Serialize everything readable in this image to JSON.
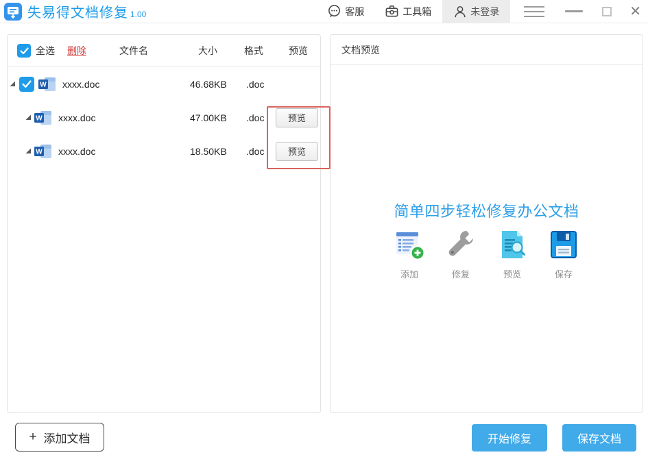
{
  "titlebar": {
    "app_title": "失易得文档修复",
    "version": "1.00",
    "service_label": "客服",
    "toolbox_label": "工具箱",
    "login_label": "未登录"
  },
  "file_panel": {
    "header": {
      "select_all": "全选",
      "delete": "删除",
      "filename": "文件名",
      "size": "大小",
      "format": "格式",
      "preview": "预览"
    },
    "rows": [
      {
        "name": "xxxx.doc",
        "size": "46.68KB",
        "format": ".doc"
      },
      {
        "name": "xxxx.doc",
        "size": "47.00KB",
        "format": ".doc",
        "preview_label": "预览"
      },
      {
        "name": "xxxx.doc",
        "size": "18.50KB",
        "format": ".doc",
        "preview_label": "预览"
      }
    ],
    "add_plus": "+",
    "add_label": "添加文档"
  },
  "preview_panel": {
    "header": "文档预览",
    "headline": "简单四步轻松修复办公文档",
    "steps": [
      {
        "label": "添加",
        "icon": "add-document-icon"
      },
      {
        "label": "修复",
        "icon": "repair-wrench-icon"
      },
      {
        "label": "预览",
        "icon": "preview-document-icon"
      },
      {
        "label": "保存",
        "icon": "save-disk-icon"
      }
    ]
  },
  "footer": {
    "start_repair": "开始修复",
    "save_document": "保存文档"
  },
  "colors": {
    "accent_blue": "#1e9be9",
    "headline_blue": "#2d9fe8",
    "button_blue": "#41aae9",
    "delete_red": "#d03a3a",
    "highlight_red": "#d9625e",
    "login_bg": "#ececec"
  }
}
